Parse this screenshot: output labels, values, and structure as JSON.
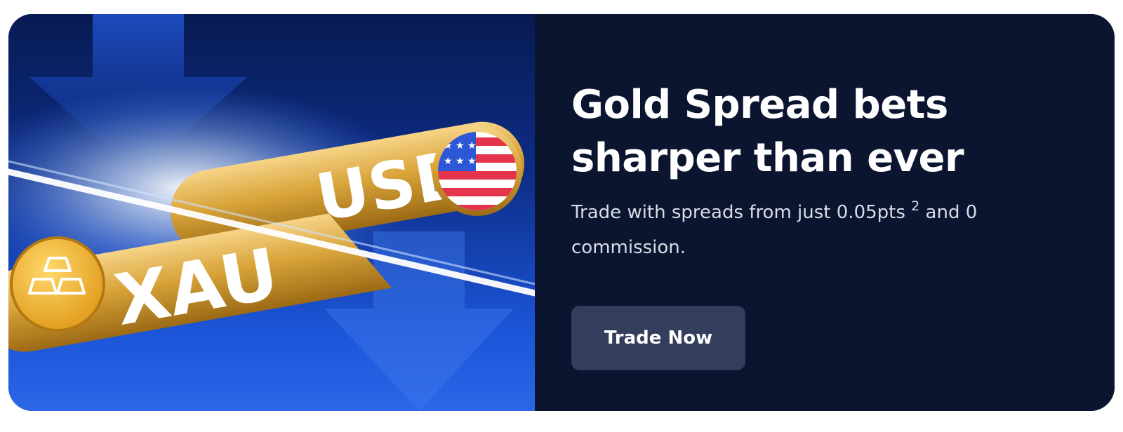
{
  "banner": {
    "headline_line1": "Gold Spread bets",
    "headline_line2": "sharper than ever",
    "subtext_before": "Trade with spreads from just 0.05pts ",
    "subtext_sup": "2",
    "subtext_after": " and 0 commission.",
    "cta_label": "Trade Now"
  },
  "hero": {
    "pill_text_front": "XAU",
    "pill_text_back": "USD",
    "gold_icon": "gold-bars-icon",
    "flag_icon": "us-flag-icon"
  },
  "colors": {
    "panel_background": "#0b1530",
    "button_background": "#333e5d",
    "gold": "#d9a43a",
    "hero_blue": "#1c55d8"
  }
}
